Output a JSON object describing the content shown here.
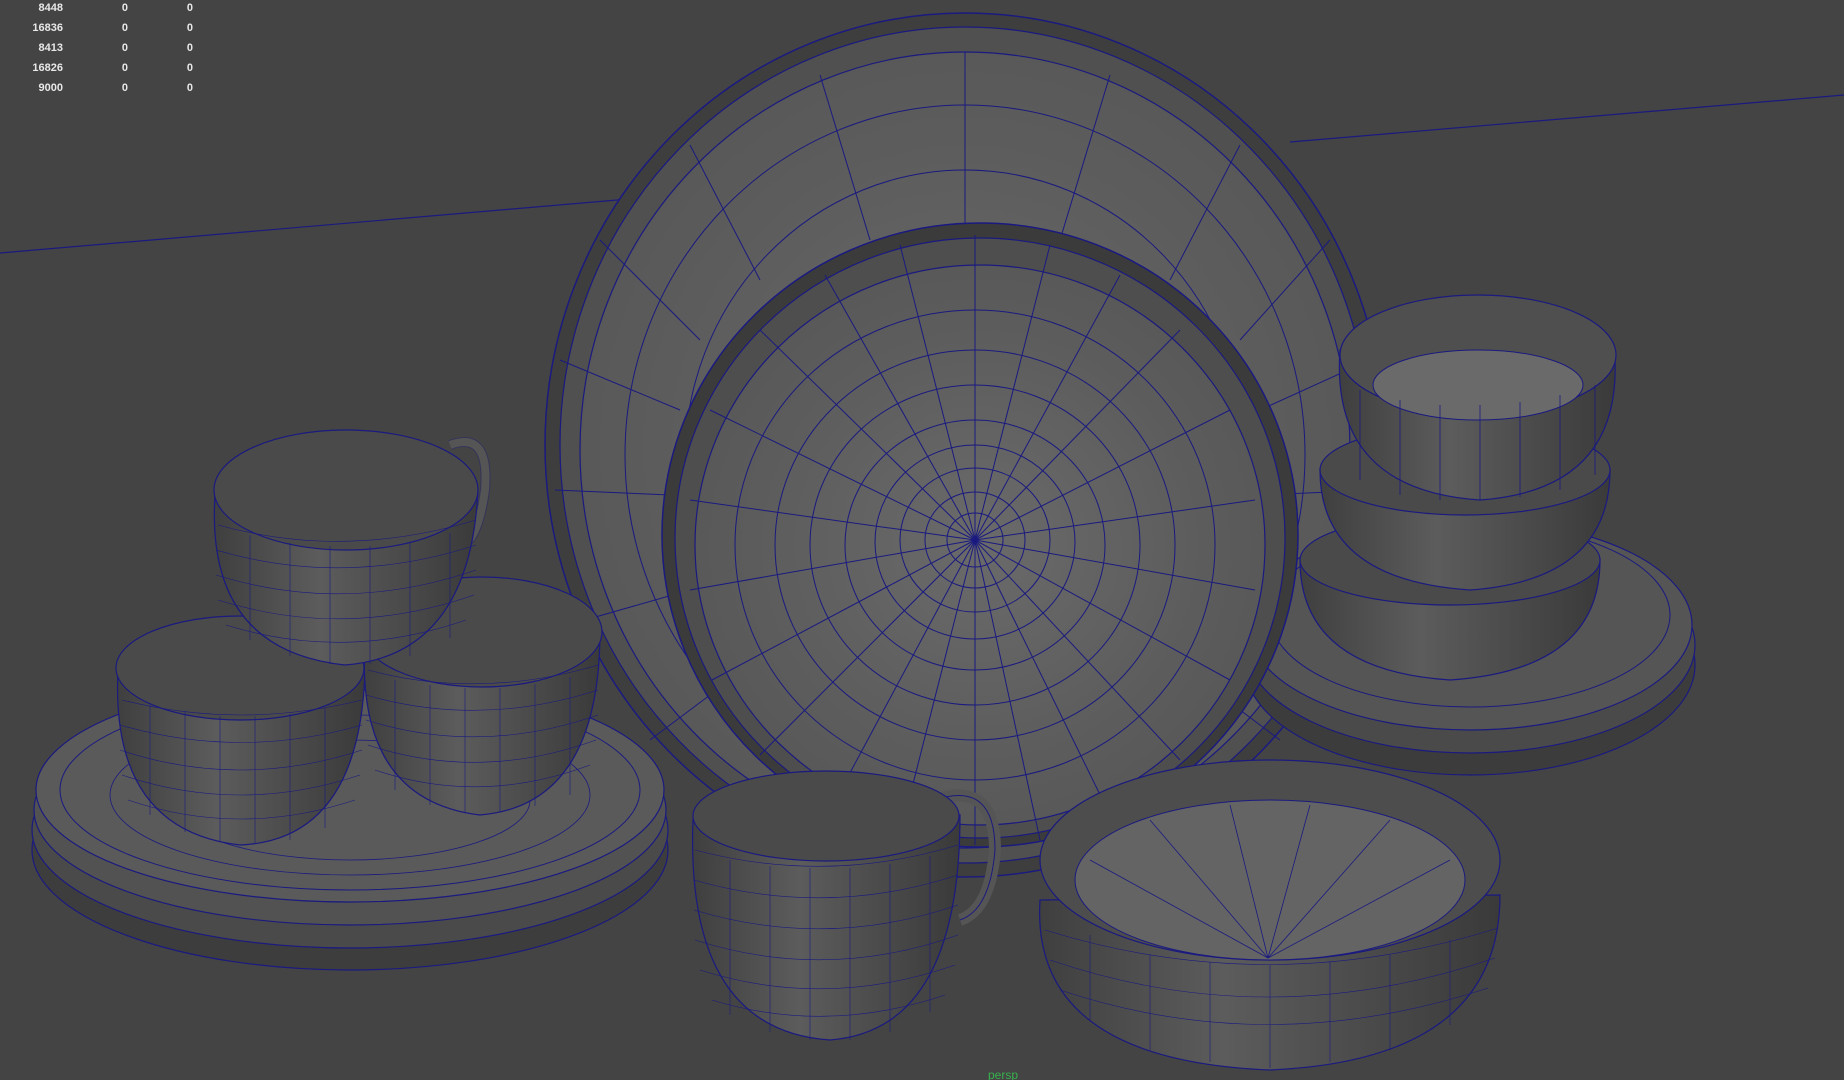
{
  "viewport": {
    "background_color": "#444444",
    "wireframe_color": "#1a1a80",
    "shaded_color": "#5e5e5e",
    "camera_name": "persp"
  },
  "heads_up_display": {
    "rows": [
      {
        "value": "8448",
        "col2": "0",
        "col3": "0"
      },
      {
        "value": "16836",
        "col2": "0",
        "col3": "0"
      },
      {
        "value": "8413",
        "col2": "0",
        "col3": "0"
      },
      {
        "value": "16826",
        "col2": "0",
        "col3": "0"
      },
      {
        "value": "9000",
        "col2": "0",
        "col3": "0"
      }
    ]
  }
}
